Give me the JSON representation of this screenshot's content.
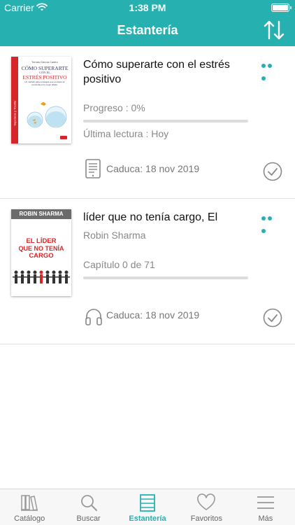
{
  "status_bar": {
    "carrier": "Carrier",
    "time": "1:38 PM"
  },
  "header": {
    "title": "Estantería"
  },
  "books": [
    {
      "title": "Cómo superarte con el estrés positivo",
      "cover": {
        "author_line": "Tomás García Castro",
        "title_lines": [
          "CÓMO SUPERARTE",
          "CON EL",
          "ESTRÉS POSITIVO"
        ],
        "subtitle": "Un método para conseguir que el estrés se convierta en tu mejor aliado.",
        "spine": "Superarse y Triunfar"
      },
      "progress_label": "Progreso : 0%",
      "progress": 0,
      "last_read": "Última lectura : Hoy",
      "format_icon": "ebook-icon",
      "expiry": "Caduca: 18 nov 2019"
    },
    {
      "title": "líder que no tenía cargo, El",
      "author": "Robin Sharma",
      "cover": {
        "author": "ROBIN SHARMA",
        "title_lines": [
          "EL LÍDER",
          "QUE NO TENÍA",
          "CARGO"
        ]
      },
      "progress_label": "Capítulo 0 de 71",
      "progress": 0,
      "format_icon": "headphones-icon",
      "expiry": "Caduca: 18 nov 2019"
    }
  ],
  "tabs": [
    {
      "label": "Catálogo",
      "icon": "books-icon",
      "active": false
    },
    {
      "label": "Buscar",
      "icon": "search-icon",
      "active": false
    },
    {
      "label": "Estantería",
      "icon": "shelf-icon",
      "active": true
    },
    {
      "label": "Favoritos",
      "icon": "heart-icon",
      "active": false
    },
    {
      "label": "Más",
      "icon": "menu-icon",
      "active": false
    }
  ],
  "colors": {
    "accent": "#27b0b0",
    "cover_red": "#d7262a"
  }
}
